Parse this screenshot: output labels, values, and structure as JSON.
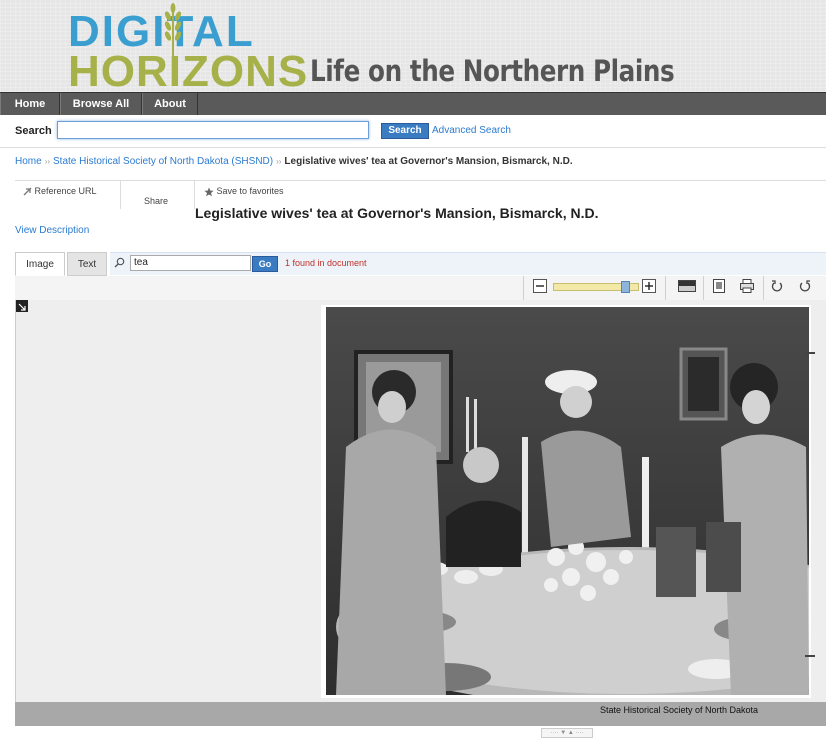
{
  "header": {
    "logo_line1": "DIGITAL",
    "logo_line2": "HORIZONS",
    "tagline": "Life on the Northern Plains",
    "colors": {
      "logo_blue": "#3a9fd0",
      "logo_green": "#a7b14a"
    }
  },
  "nav": {
    "items": [
      {
        "label": "Home"
      },
      {
        "label": "Browse All"
      },
      {
        "label": "About"
      }
    ]
  },
  "search": {
    "label": "Search",
    "value": "",
    "button": "Search",
    "advanced": "Advanced Search"
  },
  "breadcrumb": {
    "home": "Home",
    "collection": "State Historical Society of North Dakota (SHSND)",
    "current": "Legislative wives' tea at Governor's Mansion, Bismarck, N.D.",
    "sep": "››"
  },
  "tools": {
    "reference_url": "Reference URL",
    "share": "Share",
    "favorites": "Save to favorites"
  },
  "item": {
    "title": "Legislative wives' tea at Governor's Mansion, Bismarck, N.D.",
    "view_description": "View Description"
  },
  "tabs": {
    "image": "Image",
    "text": "Text"
  },
  "find": {
    "value": "tea",
    "button": "Go",
    "result": "1 found in document"
  },
  "viewer": {
    "zoom_level": 0.85,
    "credit": "State Historical Society of North Dakota"
  },
  "icons": [
    "wheat-icon",
    "link-icon",
    "star-icon",
    "search-icon",
    "zoom-out-icon",
    "zoom-in-icon",
    "contrast-icon",
    "fit-page-icon",
    "print-icon",
    "rotate-left-icon",
    "rotate-right-icon",
    "expand-icon"
  ]
}
